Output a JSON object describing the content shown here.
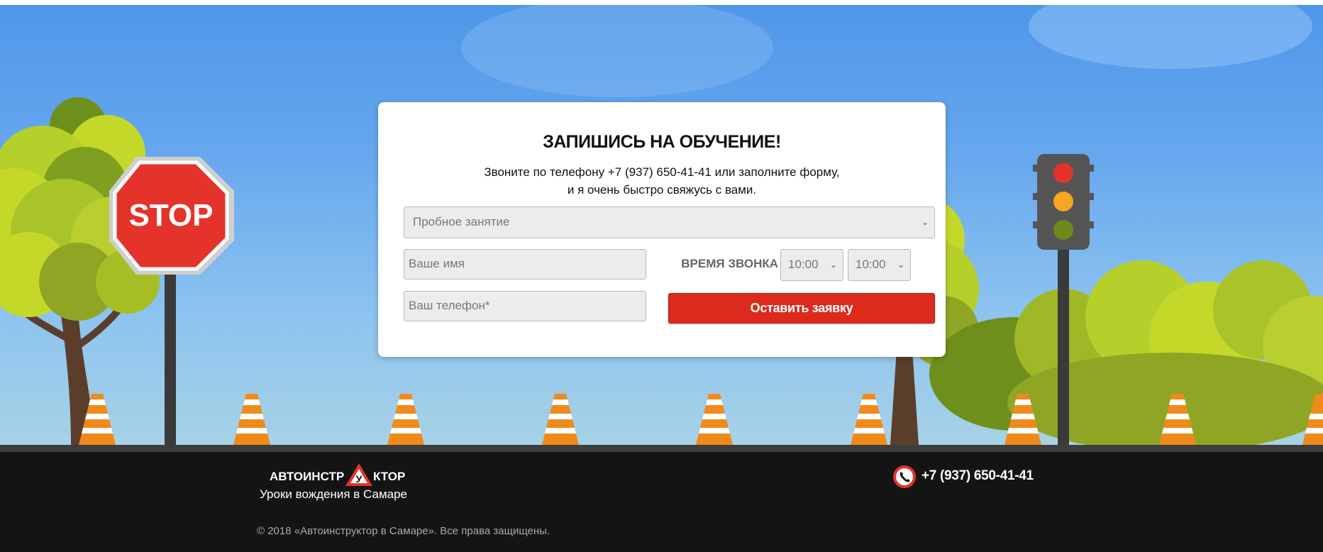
{
  "form": {
    "title": "ЗАПИШИСЬ НА ОБУЧЕНИЕ!",
    "subtitle_line1": "Звоните по телефону +7 (937) 650-41-41 или заполните форму,",
    "subtitle_line2": "и я очень быстро свяжусь с вами.",
    "course_select_value": "Пробное занятие",
    "name_placeholder": "Ваше имя",
    "phone_placeholder": "Ваш телефон*",
    "call_time_label": "ВРЕМЯ ЗВОНКА",
    "time_from": "10:00",
    "time_to": "10:00",
    "submit_label": "Оставить заявку"
  },
  "scene": {
    "stop_sign_text": "STOP"
  },
  "footer": {
    "logo_part1": "АВТОИНСТР",
    "logo_badge": "У",
    "logo_part2": "КТОР",
    "tagline": "Уроки вождения в Самаре",
    "phone": "+7 (937) 650-41-41",
    "copyright": "© 2018 «Автоинструктор в Самаре». Все права защищены."
  },
  "colors": {
    "accent": "#dc2a1c",
    "sky": "#5a9ef0",
    "footer_bg": "#141414"
  }
}
